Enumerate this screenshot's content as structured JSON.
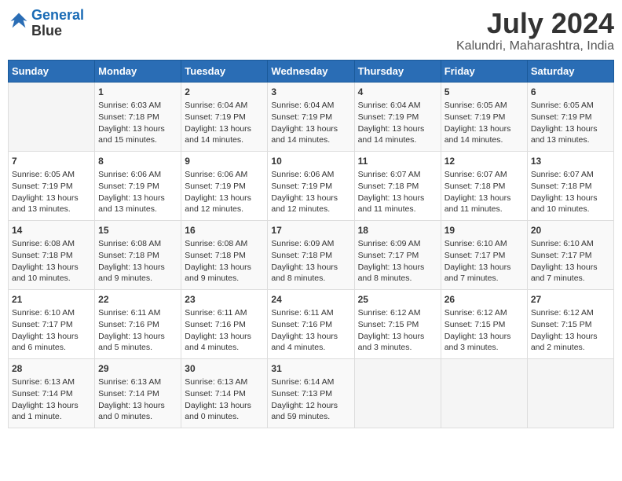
{
  "logo": {
    "line1": "General",
    "line2": "Blue"
  },
  "header": {
    "month": "July 2024",
    "location": "Kalundri, Maharashtra, India"
  },
  "days_of_week": [
    "Sunday",
    "Monday",
    "Tuesday",
    "Wednesday",
    "Thursday",
    "Friday",
    "Saturday"
  ],
  "weeks": [
    [
      {
        "day": "",
        "info": ""
      },
      {
        "day": "1",
        "info": "Sunrise: 6:03 AM\nSunset: 7:18 PM\nDaylight: 13 hours\nand 15 minutes."
      },
      {
        "day": "2",
        "info": "Sunrise: 6:04 AM\nSunset: 7:19 PM\nDaylight: 13 hours\nand 14 minutes."
      },
      {
        "day": "3",
        "info": "Sunrise: 6:04 AM\nSunset: 7:19 PM\nDaylight: 13 hours\nand 14 minutes."
      },
      {
        "day": "4",
        "info": "Sunrise: 6:04 AM\nSunset: 7:19 PM\nDaylight: 13 hours\nand 14 minutes."
      },
      {
        "day": "5",
        "info": "Sunrise: 6:05 AM\nSunset: 7:19 PM\nDaylight: 13 hours\nand 14 minutes."
      },
      {
        "day": "6",
        "info": "Sunrise: 6:05 AM\nSunset: 7:19 PM\nDaylight: 13 hours\nand 13 minutes."
      }
    ],
    [
      {
        "day": "7",
        "info": ""
      },
      {
        "day": "8",
        "info": "Sunrise: 6:06 AM\nSunset: 7:19 PM\nDaylight: 13 hours\nand 13 minutes."
      },
      {
        "day": "9",
        "info": "Sunrise: 6:06 AM\nSunset: 7:19 PM\nDaylight: 13 hours\nand 12 minutes."
      },
      {
        "day": "10",
        "info": "Sunrise: 6:06 AM\nSunset: 7:19 PM\nDaylight: 13 hours\nand 12 minutes."
      },
      {
        "day": "11",
        "info": "Sunrise: 6:07 AM\nSunset: 7:18 PM\nDaylight: 13 hours\nand 11 minutes."
      },
      {
        "day": "12",
        "info": "Sunrise: 6:07 AM\nSunset: 7:18 PM\nDaylight: 13 hours\nand 11 minutes."
      },
      {
        "day": "13",
        "info": "Sunrise: 6:07 AM\nSunset: 7:18 PM\nDaylight: 13 hours\nand 10 minutes."
      }
    ],
    [
      {
        "day": "14",
        "info": ""
      },
      {
        "day": "15",
        "info": "Sunrise: 6:08 AM\nSunset: 7:18 PM\nDaylight: 13 hours\nand 9 minutes."
      },
      {
        "day": "16",
        "info": "Sunrise: 6:08 AM\nSunset: 7:18 PM\nDaylight: 13 hours\nand 9 minutes."
      },
      {
        "day": "17",
        "info": "Sunrise: 6:09 AM\nSunset: 7:18 PM\nDaylight: 13 hours\nand 8 minutes."
      },
      {
        "day": "18",
        "info": "Sunrise: 6:09 AM\nSunset: 7:17 PM\nDaylight: 13 hours\nand 8 minutes."
      },
      {
        "day": "19",
        "info": "Sunrise: 6:10 AM\nSunset: 7:17 PM\nDaylight: 13 hours\nand 7 minutes."
      },
      {
        "day": "20",
        "info": "Sunrise: 6:10 AM\nSunset: 7:17 PM\nDaylight: 13 hours\nand 7 minutes."
      }
    ],
    [
      {
        "day": "21",
        "info": ""
      },
      {
        "day": "22",
        "info": "Sunrise: 6:11 AM\nSunset: 7:16 PM\nDaylight: 13 hours\nand 5 minutes."
      },
      {
        "day": "23",
        "info": "Sunrise: 6:11 AM\nSunset: 7:16 PM\nDaylight: 13 hours\nand 4 minutes."
      },
      {
        "day": "24",
        "info": "Sunrise: 6:11 AM\nSunset: 7:16 PM\nDaylight: 13 hours\nand 4 minutes."
      },
      {
        "day": "25",
        "info": "Sunrise: 6:12 AM\nSunset: 7:15 PM\nDaylight: 13 hours\nand 3 minutes."
      },
      {
        "day": "26",
        "info": "Sunrise: 6:12 AM\nSunset: 7:15 PM\nDaylight: 13 hours\nand 3 minutes."
      },
      {
        "day": "27",
        "info": "Sunrise: 6:12 AM\nSunset: 7:15 PM\nDaylight: 13 hours\nand 2 minutes."
      }
    ],
    [
      {
        "day": "28",
        "info": ""
      },
      {
        "day": "29",
        "info": "Sunrise: 6:13 AM\nSunset: 7:14 PM\nDaylight: 13 hours\nand 0 minutes."
      },
      {
        "day": "30",
        "info": "Sunrise: 6:13 AM\nSunset: 7:14 PM\nDaylight: 13 hours\nand 0 minutes."
      },
      {
        "day": "31",
        "info": "Sunrise: 6:14 AM\nSunset: 7:13 PM\nDaylight: 12 hours\nand 59 minutes."
      },
      {
        "day": "",
        "info": ""
      },
      {
        "day": "",
        "info": ""
      },
      {
        "day": "",
        "info": ""
      }
    ]
  ],
  "week1_row0_sunday_info": "",
  "special_days": {
    "7": "Sunrise: 6:05 AM\nSunset: 7:19 PM\nDaylight: 13 hours\nand 13 minutes.",
    "14": "Sunrise: 6:08 AM\nSunset: 7:18 PM\nDaylight: 13 hours\nand 10 minutes.",
    "21": "Sunrise: 6:10 AM\nSunset: 7:17 PM\nDaylight: 13 hours\nand 6 minutes.",
    "28": "Sunrise: 6:13 AM\nSunset: 7:14 PM\nDaylight: 13 hours\nand 1 minute."
  }
}
